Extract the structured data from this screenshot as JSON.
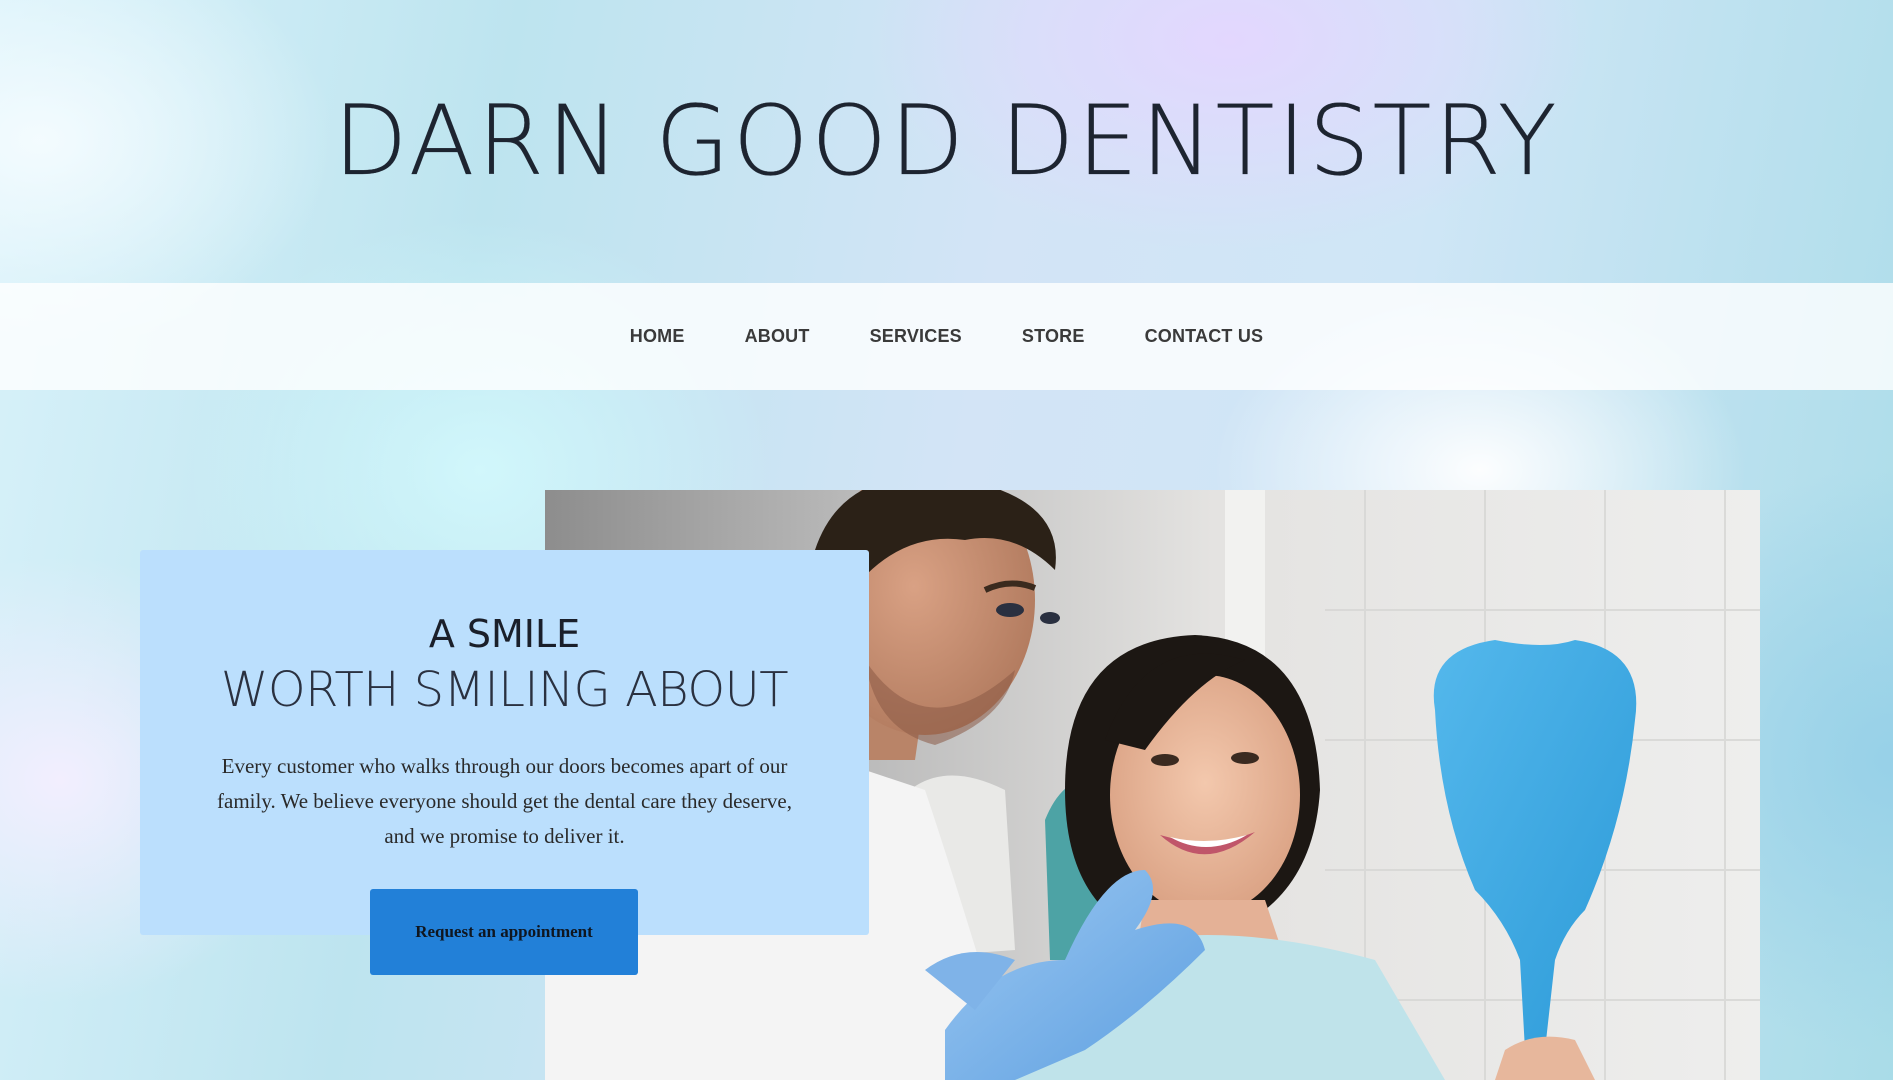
{
  "header": {
    "site_title": "DARN GOOD DENTISTRY"
  },
  "nav": {
    "items": [
      {
        "label": "HOME"
      },
      {
        "label": "ABOUT"
      },
      {
        "label": "SERVICES"
      },
      {
        "label": "STORE"
      },
      {
        "label": "CONTACT US"
      }
    ]
  },
  "hero": {
    "headline_line1": "A SMILE",
    "headline_line2": "WORTH SMILING ABOUT",
    "body": "Every customer who walks through our doors becomes apart of our family. We believe everyone should get the dental care they deserve, and we promise to deliver it.",
    "cta_label": "Request an appointment",
    "image_icon": "dentist-patient-photo"
  },
  "colors": {
    "card_background": "#bbdffd",
    "cta_background": "#2280d8",
    "title_text": "#1d2430",
    "nav_text": "#3a3a3a"
  }
}
